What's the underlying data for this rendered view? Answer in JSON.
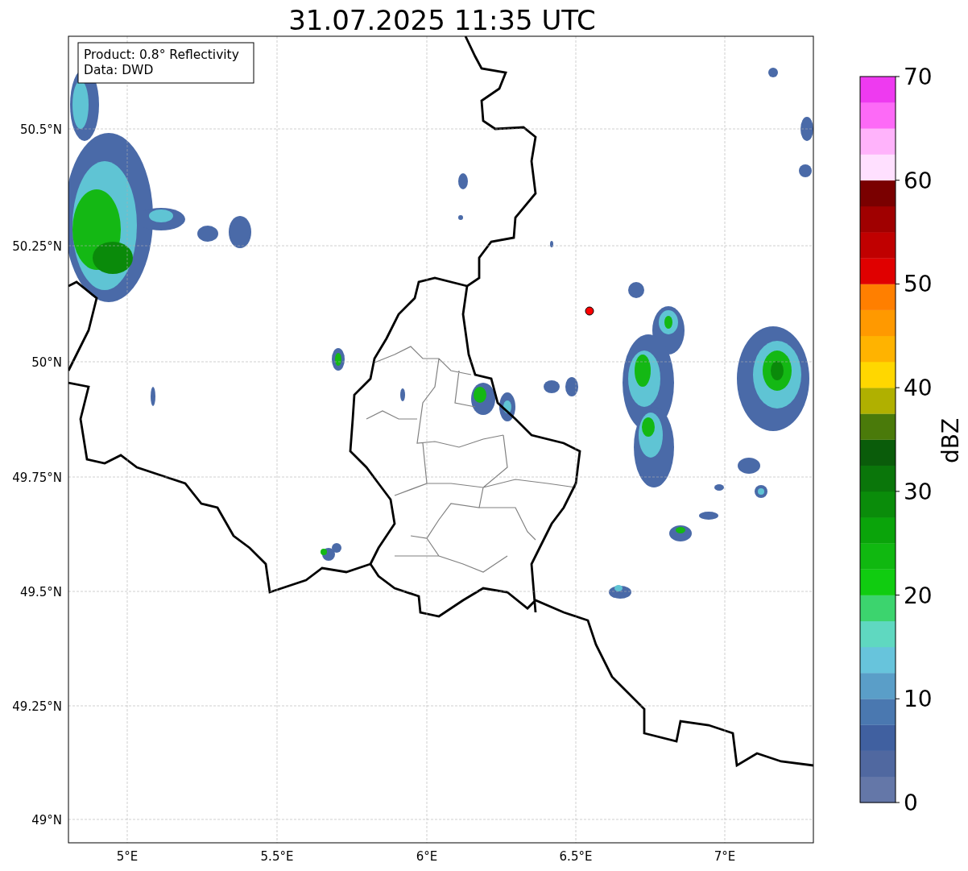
{
  "title": "31.07.2025 11:35 UTC",
  "info_box": [
    "Product: 0.8° Reflectivity",
    "Data: DWD"
  ],
  "map": {
    "lat_ticks": [
      "50.5°N",
      "50.25°N",
      "50°N",
      "49.75°N",
      "49.5°N",
      "49.25°N",
      "49°N"
    ],
    "lon_ticks": [
      "5°E",
      "5.5°E",
      "6°E",
      "6.5°E",
      "7°E"
    ]
  },
  "colorbar": {
    "label": "dBZ",
    "ticks": [
      "70",
      "60",
      "50",
      "40",
      "30",
      "20",
      "10",
      "0"
    ],
    "segments": [
      {
        "color": "#6477a8"
      },
      {
        "color": "#5068a0"
      },
      {
        "color": "#4060a0"
      },
      {
        "color": "#4a78b0"
      },
      {
        "color": "#5a9ec8"
      },
      {
        "color": "#67c4dc"
      },
      {
        "color": "#5fd8c0"
      },
      {
        "color": "#3cd46e"
      },
      {
        "color": "#10cc10"
      },
      {
        "color": "#10b810"
      },
      {
        "color": "#0aa40a"
      },
      {
        "color": "#0a8c0a"
      },
      {
        "color": "#0a760a"
      },
      {
        "color": "#0a5c0a"
      },
      {
        "color": "#4a7a0a"
      },
      {
        "color": "#b0b000"
      },
      {
        "color": "#ffd700"
      },
      {
        "color": "#ffb300"
      },
      {
        "color": "#ff9900"
      },
      {
        "color": "#ff7f00"
      },
      {
        "color": "#e00000"
      },
      {
        "color": "#c00000"
      },
      {
        "color": "#a00000"
      },
      {
        "color": "#7a0000"
      },
      {
        "color": "#ffe0ff"
      },
      {
        "color": "#ffb3fb"
      },
      {
        "color": "#fd6af7"
      },
      {
        "color": "#ee3af0"
      }
    ]
  }
}
